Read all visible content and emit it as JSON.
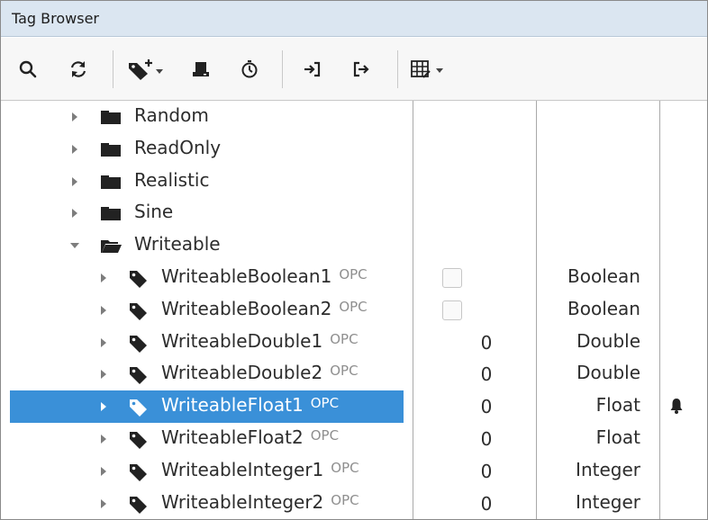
{
  "window": {
    "title": "Tag Browser"
  },
  "toolbar": {
    "buttons": [
      {
        "icon": "search-icon"
      },
      {
        "icon": "refresh-icon"
      },
      {
        "icon": "add-tag-dropdown-icon"
      },
      {
        "icon": "device-icon"
      },
      {
        "icon": "history-icon"
      },
      {
        "icon": "import-icon"
      },
      {
        "icon": "export-icon"
      },
      {
        "icon": "table-columns-dropdown-icon"
      }
    ]
  },
  "tree": {
    "folders": [
      {
        "label": "Random",
        "expanded": false
      },
      {
        "label": "ReadOnly",
        "expanded": false
      },
      {
        "label": "Realistic",
        "expanded": false
      },
      {
        "label": "Sine",
        "expanded": false
      },
      {
        "label": "Writeable",
        "expanded": true
      }
    ],
    "tags": [
      {
        "name": "WriteableBoolean1",
        "source": "OPC",
        "value_kind": "checkbox",
        "value": "",
        "checked": false,
        "datatype": "Boolean",
        "selected": false,
        "alarm": false
      },
      {
        "name": "WriteableBoolean2",
        "source": "OPC",
        "value_kind": "checkbox",
        "value": "",
        "checked": false,
        "datatype": "Boolean",
        "selected": false,
        "alarm": false
      },
      {
        "name": "WriteableDouble1",
        "source": "OPC",
        "value_kind": "text",
        "value": "0",
        "datatype": "Double",
        "selected": false,
        "alarm": false
      },
      {
        "name": "WriteableDouble2",
        "source": "OPC",
        "value_kind": "text",
        "value": "0",
        "datatype": "Double",
        "selected": false,
        "alarm": false
      },
      {
        "name": "WriteableFloat1",
        "source": "OPC",
        "value_kind": "text",
        "value": "0",
        "datatype": "Float",
        "selected": true,
        "alarm": true
      },
      {
        "name": "WriteableFloat2",
        "source": "OPC",
        "value_kind": "text",
        "value": "0",
        "datatype": "Float",
        "selected": false,
        "alarm": false
      },
      {
        "name": "WriteableInteger1",
        "source": "OPC",
        "value_kind": "text",
        "value": "0",
        "datatype": "Integer",
        "selected": false,
        "alarm": false
      },
      {
        "name": "WriteableInteger2",
        "source": "OPC",
        "value_kind": "text",
        "value": "0",
        "datatype": "Integer",
        "selected": false,
        "alarm": false
      }
    ]
  },
  "colors": {
    "title_bg": "#dbe6f1",
    "selection": "#3a90d8",
    "icon_dark": "#222222"
  }
}
